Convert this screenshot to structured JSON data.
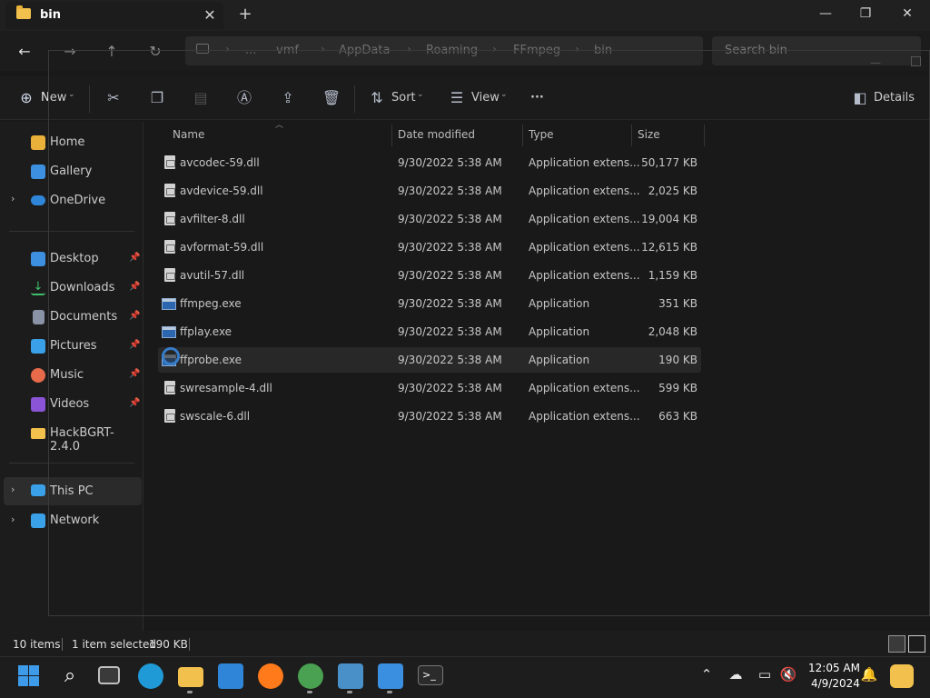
{
  "window": {
    "tab_title": "bin",
    "tab_close": "✕",
    "new_tab": "+",
    "minimize": "—",
    "maximize": "❐",
    "close": "✕"
  },
  "address": {
    "more": "...",
    "crumbs": [
      "vmf",
      "AppData",
      "Roaming",
      "FFmpeg",
      "bin"
    ],
    "separator": "›",
    "search_placeholder": "Search bin"
  },
  "toolbar": {
    "new_label": "New",
    "sort_label": "Sort",
    "view_label": "View",
    "more_label": "···",
    "details_label": "Details"
  },
  "sidebar": {
    "items": [
      {
        "label": "Home",
        "icon": "home-icon",
        "color": "#e9b13a"
      },
      {
        "label": "Gallery",
        "icon": "gallery-icon",
        "color": "#3d8fe0"
      },
      {
        "label": "OneDrive",
        "icon": "cloud-icon",
        "color": "#2f86d8"
      },
      {
        "label": "Desktop",
        "icon": "desktop-icon",
        "color": "#3d8fe0"
      },
      {
        "label": "Downloads",
        "icon": "download-icon",
        "color": "#3fbf6a"
      },
      {
        "label": "Documents",
        "icon": "document-icon",
        "color": "#8a93a6"
      },
      {
        "label": "Pictures",
        "icon": "pictures-icon",
        "color": "#3aa0e8"
      },
      {
        "label": "Music",
        "icon": "music-icon",
        "color": "#e76a4a"
      },
      {
        "label": "Videos",
        "icon": "video-icon",
        "color": "#8b54d6"
      },
      {
        "label": "HackBGRT-2.4.0",
        "icon": "folder-icon",
        "color": "#f2c04c"
      },
      {
        "label": "This PC",
        "icon": "computer-icon",
        "color": "#3aa0e8"
      },
      {
        "label": "Network",
        "icon": "network-icon",
        "color": "#3aa0e8"
      }
    ],
    "pin": "📌",
    "chevron": "›"
  },
  "columns": {
    "name": "Name",
    "date": "Date modified",
    "type": "Type",
    "size": "Size"
  },
  "files": [
    {
      "name": "avcodec-59.dll",
      "date": "9/30/2022 5:38 AM",
      "type": "Application extens...",
      "size": "50,177 KB",
      "kind": "dll"
    },
    {
      "name": "avdevice-59.dll",
      "date": "9/30/2022 5:38 AM",
      "type": "Application extens...",
      "size": "2,025 KB",
      "kind": "dll"
    },
    {
      "name": "avfilter-8.dll",
      "date": "9/30/2022 5:38 AM",
      "type": "Application extens...",
      "size": "19,004 KB",
      "kind": "dll"
    },
    {
      "name": "avformat-59.dll",
      "date": "9/30/2022 5:38 AM",
      "type": "Application extens...",
      "size": "12,615 KB",
      "kind": "dll"
    },
    {
      "name": "avutil-57.dll",
      "date": "9/30/2022 5:38 AM",
      "type": "Application extens...",
      "size": "1,159 KB",
      "kind": "dll"
    },
    {
      "name": "ffmpeg.exe",
      "date": "9/30/2022 5:38 AM",
      "type": "Application",
      "size": "351 KB",
      "kind": "exe"
    },
    {
      "name": "ffplay.exe",
      "date": "9/30/2022 5:38 AM",
      "type": "Application",
      "size": "2,048 KB",
      "kind": "exe"
    },
    {
      "name": "ffprobe.exe",
      "date": "9/30/2022 5:38 AM",
      "type": "Application",
      "size": "190 KB",
      "kind": "exe"
    },
    {
      "name": "swresample-4.dll",
      "date": "9/30/2022 5:38 AM",
      "type": "Application extens...",
      "size": "599 KB",
      "kind": "dll"
    },
    {
      "name": "swscale-6.dll",
      "date": "9/30/2022 5:38 AM",
      "type": "Application extens...",
      "size": "663 KB",
      "kind": "dll"
    }
  ],
  "status": {
    "count": "10 items",
    "selected": "1 item selected",
    "selected_size": "190 KB"
  },
  "taskbar": {
    "clock_time": "12:05 AM",
    "clock_date": "4/9/2024",
    "apps": [
      {
        "name": "start",
        "color": "#3d9be9"
      },
      {
        "name": "search",
        "color": "#1d1d1d"
      },
      {
        "name": "task-view",
        "color": "#1d1d1d"
      },
      {
        "name": "edge",
        "color": "#1f9ad6"
      },
      {
        "name": "file-explorer",
        "color": "#f2c04c"
      },
      {
        "name": "store",
        "color": "#2f86d8"
      },
      {
        "name": "firefox",
        "color": "#ff7a1a"
      },
      {
        "name": "chrome",
        "color": "#4aa151"
      },
      {
        "name": "remote-desktop",
        "color": "#4a90c8"
      },
      {
        "name": "paint",
        "color": "#3b8fe0"
      },
      {
        "name": "terminal",
        "color": "#2b2b2b"
      }
    ]
  }
}
